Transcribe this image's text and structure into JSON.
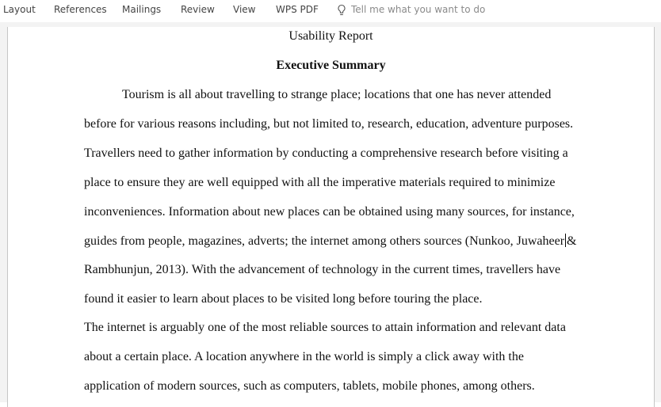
{
  "ribbon": {
    "tabs": [
      {
        "label": "Layout"
      },
      {
        "label": "References"
      },
      {
        "label": "Mailings"
      },
      {
        "label": "Review"
      },
      {
        "label": "View"
      },
      {
        "label": "WPS PDF"
      }
    ],
    "tell_me": {
      "icon": "lightbulb-icon",
      "placeholder": "Tell me what you want to do"
    }
  },
  "document": {
    "title": "Usability Report",
    "heading": "Executive Summary",
    "lines": [
      "Tourism is all about travelling to strange place; locations that one has never attended",
      "before for various reasons including, but not limited to, research, education, adventure purposes.",
      "Travellers need to gather information by conducting a comprehensive research before visiting a",
      "place to ensure they are well equipped with all the imperative materials required to minimize",
      "inconveniences. Information about new places can be obtained using many sources, for instance,",
      "guides from people, magazines, adverts; the internet among others sources (Nunkoo, Juwaheer",
      "&",
      "Rambhunjun, 2013). With the advancement of technology in the current times, travellers have",
      "found it easier to learn about places to be visited long before touring the place.",
      "The internet is arguably one of the most reliable sources to attain information and relevant data",
      "about a certain place. A location anywhere in the world is simply a click away with the",
      "application of modern sources, such as computers, tablets, mobile phones, among others."
    ]
  }
}
